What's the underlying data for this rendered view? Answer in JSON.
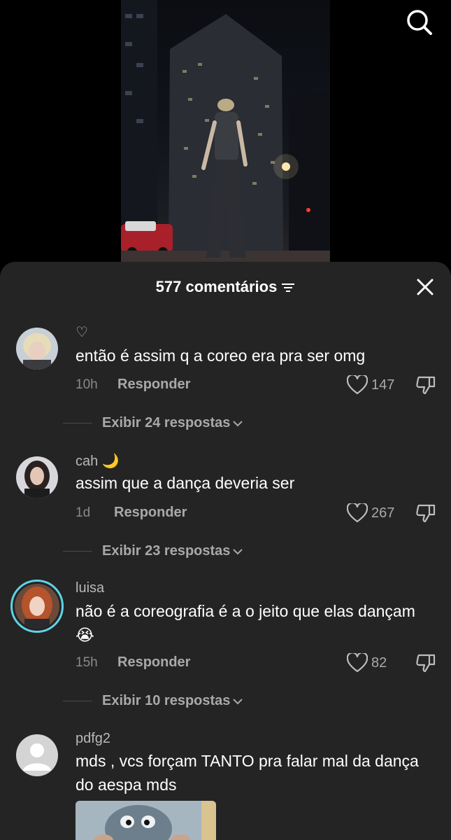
{
  "video": {
    "search_icon": "search-icon"
  },
  "comments_sheet": {
    "title": "577 comentários",
    "filter_icon": "filter-icon",
    "close_icon": "close-icon",
    "reply_label": "Responder",
    "comments": [
      {
        "username": "♡",
        "text": "então é assim q a coreo era pra ser omg",
        "time": "10h",
        "likes": "147",
        "replies_label": "Exibir 24 respostas"
      },
      {
        "username": "cah 🌙",
        "text": "assim que a dança deveria ser",
        "time": "1d",
        "likes": "267",
        "replies_label": "Exibir 23 respostas"
      },
      {
        "username": "luisa",
        "text": "não é a coreografia é a o jeito que elas dançam 😭",
        "time": "15h",
        "likes": "82",
        "replies_label": "Exibir 10 respostas"
      },
      {
        "username": "pdfg2",
        "text": "mds , vcs forçam TANTO pra falar mal da dança do aespa mds"
      }
    ]
  },
  "colors": {
    "sheet_bg": "#242424",
    "text_primary": "#ffffff",
    "text_secondary": "#a9a9a9",
    "story_ring": "#5fd3e6"
  }
}
